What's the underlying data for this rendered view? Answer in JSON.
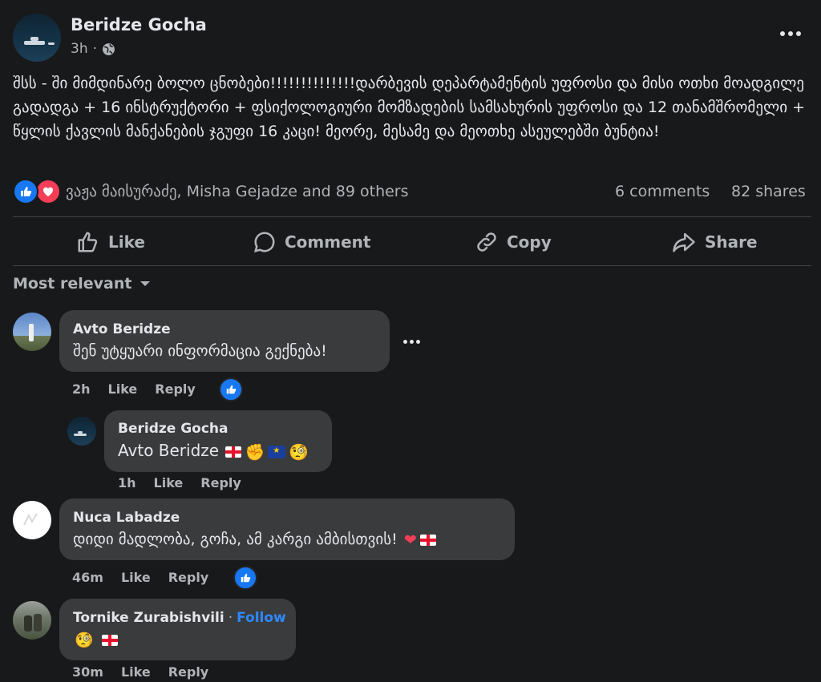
{
  "post": {
    "author": "Beridze Gocha",
    "time": "3h",
    "text": "შსს - ში მიმდინარე ბოლო ცნობები!!!!!!!!!!!!!!დარბევის დეპარტამენტის უფროსი და მისი ოთხი მოადგილე გადადგა + 16 ინსტრუქტორი + ფსიქოლოგიური მომზადების სამსახურის უფროსი და 12 თანამშრომელი + წყლის ქავლის მანქანების ჯგუფი 16 კაცი! მეორე, მესამე და მეოთხე ასეულებში ბუნტია!",
    "reactors": "ვაჟა მაისურაძე, Misha Gejadze and 89 others",
    "comments_count": "6 comments",
    "shares_count": "82 shares"
  },
  "actions": {
    "like": "Like",
    "comment": "Comment",
    "copy": "Copy",
    "share": "Share"
  },
  "sort": {
    "label": "Most relevant"
  },
  "comments": [
    {
      "name": "Avto Beridze",
      "text": "შენ უტყუარი ინფორმაცია გექნება!",
      "time": "2h",
      "like": "Like",
      "reply": "Reply"
    },
    {
      "name": "Beridze Gocha",
      "text": "Avto Beridze",
      "time": "1h",
      "like": "Like",
      "reply": "Reply"
    },
    {
      "name": "Nuca Labadze",
      "text": "დიდი მადლობა, გოჩა, ამ კარგი ამბისთვის!",
      "time": "46m",
      "like": "Like",
      "reply": "Reply"
    },
    {
      "name": "Tornike Zurabishvili",
      "follow_sep": "·",
      "follow": "Follow",
      "time": "30m",
      "like": "Like",
      "reply": "Reply"
    }
  ],
  "colors": {
    "accent": "#1877f2",
    "background": "#18191a",
    "bubble": "#3a3b3c",
    "love": "#f33e58"
  },
  "icons": [
    "globe-icon",
    "more-icon",
    "like-reaction-icon",
    "love-reaction-icon",
    "thumbs-up-icon",
    "comment-icon",
    "link-icon",
    "share-icon",
    "caret-down-icon"
  ]
}
